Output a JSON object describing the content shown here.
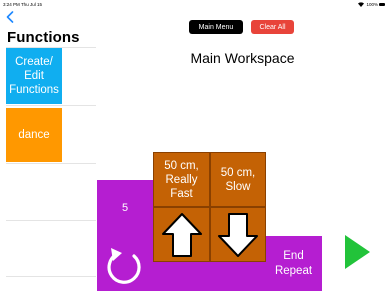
{
  "status_bar": {
    "time": "3:24 PM",
    "date": "Thu Jul 15",
    "battery_percent": "100%",
    "wifi_icon": "wifi-icon",
    "battery_icon": "battery-icon"
  },
  "sidebar": {
    "title": "Functions",
    "back_icon": "chevron-left-icon",
    "items": [
      {
        "label": "Create/\nEdit\nFunctions",
        "color": "#10aef0"
      },
      {
        "label": "dance",
        "color": "#ff9800"
      }
    ]
  },
  "header": {
    "main_menu_label": "Main Menu",
    "clear_all_label": "Clear All",
    "title": "Main Workspace"
  },
  "workspace": {
    "repeat_count": "5",
    "repeat_icon": "repeat-loop-icon",
    "end_repeat_label": "End\nRepeat",
    "moves": [
      {
        "label": "50 cm,\nReally\nFast",
        "direction_icon": "arrow-up-icon"
      },
      {
        "label": "50 cm,\nSlow",
        "direction_icon": "arrow-down-icon"
      }
    ],
    "colors": {
      "loop": "#b51ed1",
      "move": "#c46205"
    }
  },
  "run": {
    "icon": "play-icon",
    "color": "#22c33a"
  }
}
